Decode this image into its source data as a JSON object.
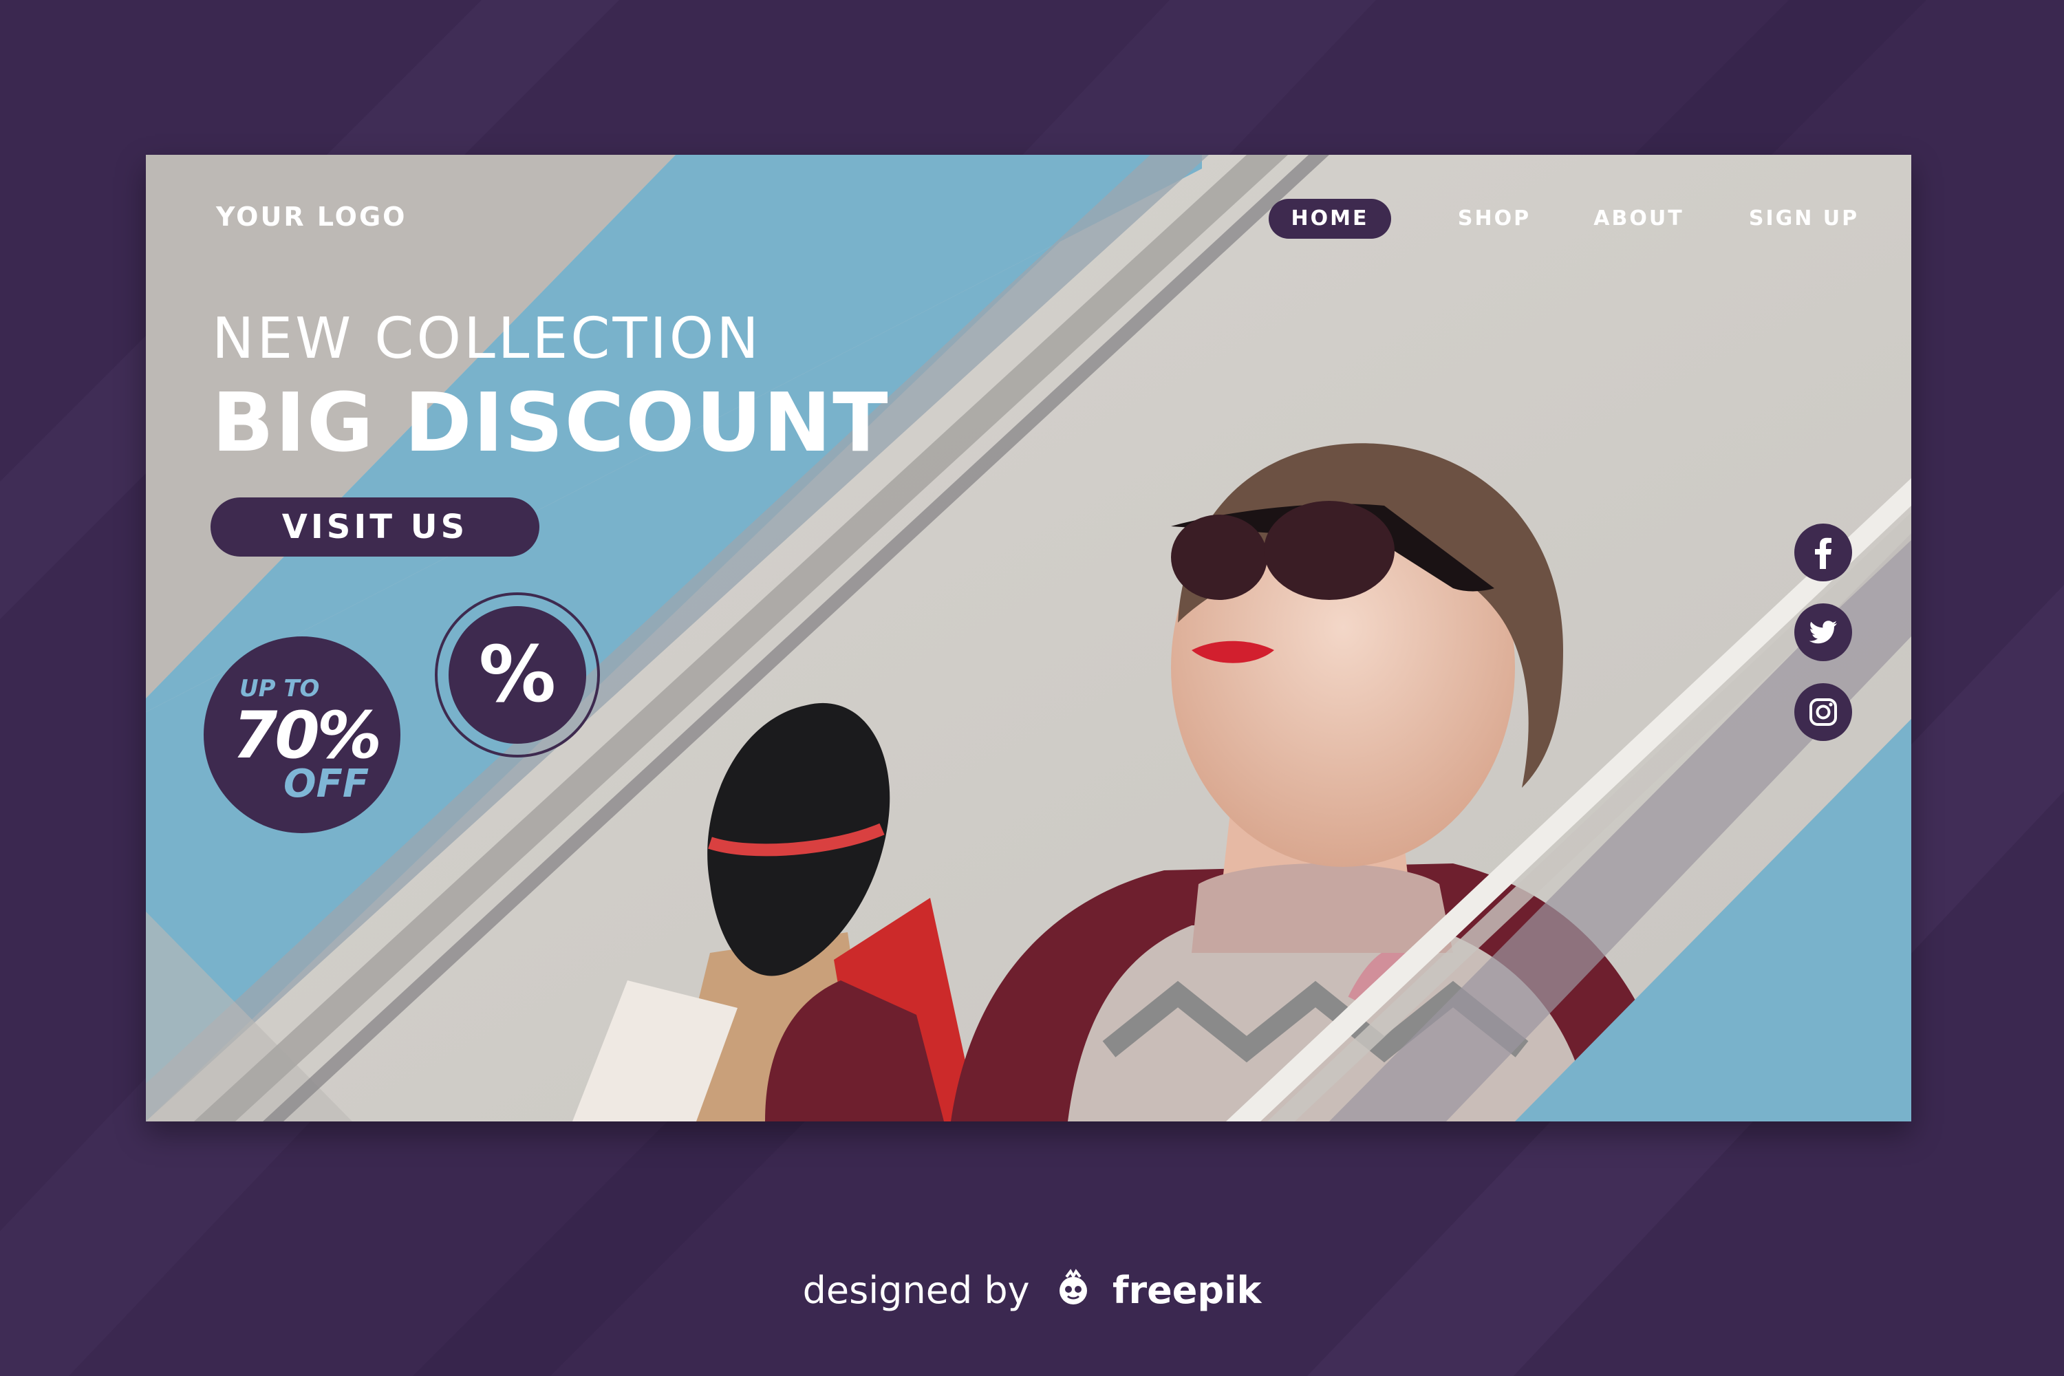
{
  "colors": {
    "page_bg": "#3b2850",
    "card_gray": "#bdb9b5",
    "accent_blue": "#79b2cb",
    "accent_purple": "#3e2a4f",
    "accent_text_blue": "#7fb6d6"
  },
  "header": {
    "logo": "YOUR LOGO",
    "nav": [
      {
        "label": "HOME",
        "active": true
      },
      {
        "label": "SHOP",
        "active": false
      },
      {
        "label": "ABOUT",
        "active": false
      },
      {
        "label": "SIGN UP",
        "active": false
      }
    ]
  },
  "hero": {
    "subtitle": "NEW COLLECTION",
    "title": "BIG DISCOUNT",
    "cta_label": "VISIT US",
    "badge": {
      "line1": "UP TO",
      "line2": "70%",
      "line3": "OFF"
    },
    "percent_symbol": "%"
  },
  "social": [
    {
      "icon": "facebook-icon"
    },
    {
      "icon": "twitter-icon"
    },
    {
      "icon": "instagram-icon"
    }
  ],
  "footer": {
    "credit_prefix": "designed by",
    "brand": "freepik"
  }
}
